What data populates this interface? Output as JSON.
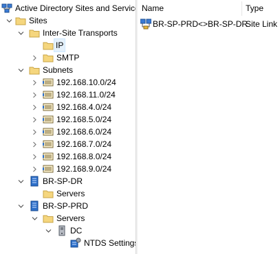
{
  "tree": {
    "root": {
      "label": "Active Directory Sites and Services",
      "icon": "sites-services-icon"
    },
    "sites": {
      "label": "Sites",
      "icon": "folder-icon"
    },
    "inter_site": {
      "label": "Inter-Site Transports",
      "icon": "folder-icon"
    },
    "ip": {
      "label": "IP",
      "icon": "folder-icon"
    },
    "smtp": {
      "label": "SMTP",
      "icon": "folder-icon"
    },
    "subnets": {
      "label": "Subnets",
      "icon": "folder-icon"
    },
    "subnet_items": [
      {
        "label": "192.168.10.0/24"
      },
      {
        "label": "192.168.11.0/24"
      },
      {
        "label": "192.168.4.0/24"
      },
      {
        "label": "192.168.5.0/24"
      },
      {
        "label": "192.168.6.0/24"
      },
      {
        "label": "192.168.7.0/24"
      },
      {
        "label": "192.168.8.0/24"
      },
      {
        "label": "192.168.9.0/24"
      }
    ],
    "site_dr": {
      "label": "BR-SP-DR",
      "icon": "site-icon"
    },
    "site_dr_servers": {
      "label": "Servers",
      "icon": "folder-icon"
    },
    "site_prd": {
      "label": "BR-SP-PRD",
      "icon": "site-icon"
    },
    "site_prd_servers": {
      "label": "Servers",
      "icon": "folder-icon"
    },
    "dc": {
      "label": "DC",
      "icon": "server-icon"
    },
    "ntds": {
      "label": "NTDS Settings",
      "icon": "ntds-settings-icon"
    }
  },
  "list": {
    "columns": [
      {
        "label": "Name"
      },
      {
        "label": "Type"
      }
    ],
    "rows": [
      {
        "name": "BR-SP-PRD<>BR-SP-DR",
        "type": "Site Link",
        "icon": "site-link-icon"
      }
    ]
  },
  "colors": {
    "selection": "#e5f1fb",
    "folder": "#f5d67e",
    "site": "#2c6fc9"
  }
}
